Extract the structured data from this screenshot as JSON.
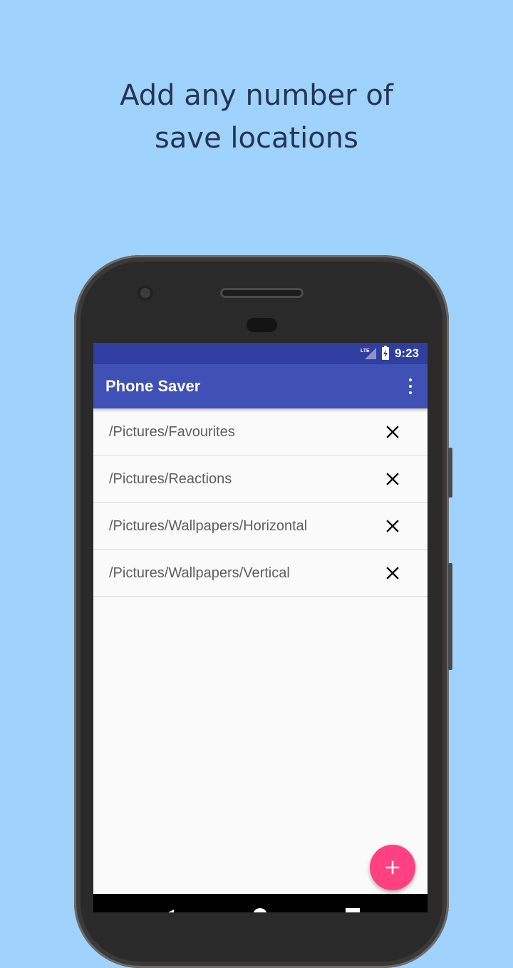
{
  "promo": {
    "headline_line1": "Add any number of",
    "headline_line2": "save locations"
  },
  "statusbar": {
    "network": "LTE",
    "time": "9:23"
  },
  "appbar": {
    "title": "Phone Saver",
    "overflow_icon": "more-vert-icon"
  },
  "locations": [
    {
      "path": "/Pictures/Favourites",
      "remove_icon": "close-icon"
    },
    {
      "path": "/Pictures/Reactions",
      "remove_icon": "close-icon"
    },
    {
      "path": "/Pictures/Wallpapers/Horizontal",
      "remove_icon": "close-icon"
    },
    {
      "path": "/Pictures/Wallpapers/Vertical",
      "remove_icon": "close-icon"
    }
  ],
  "fab": {
    "icon": "plus-icon"
  },
  "navbar": {
    "icons": [
      "back-icon",
      "home-icon",
      "recents-icon"
    ]
  },
  "colors": {
    "background": "#9fd2fc",
    "status_bar": "#303f9f",
    "app_bar": "#3f51b5",
    "accent": "#ff4081",
    "headline_text": "#253650"
  }
}
